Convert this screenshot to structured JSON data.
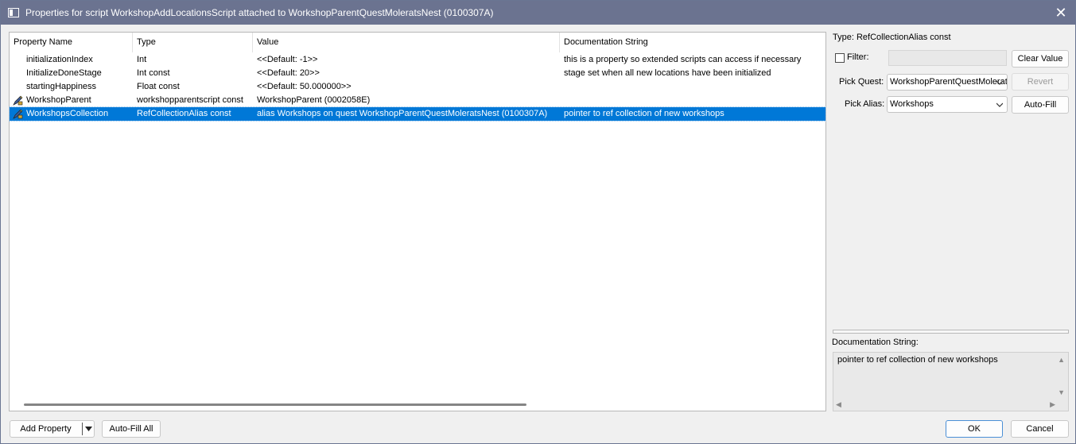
{
  "window": {
    "title": "Properties for script WorkshopAddLocationsScript attached to WorkshopParentQuestMoleratsNest (0100307A)",
    "close_glyph": "✕"
  },
  "table": {
    "columns": [
      "Property Name",
      "Type",
      "Value",
      "Documentation String"
    ],
    "rows": [
      {
        "name": "initializationIndex",
        "type": "Int",
        "value": "<<Default: -1>>",
        "doc": "this is a property so extended scripts can access if necessary",
        "icon": "",
        "selected": false
      },
      {
        "name": "InitializeDoneStage",
        "type": "Int const",
        "value": "<<Default: 20>>",
        "doc": "stage set when all new locations have been initialized",
        "icon": "",
        "selected": false
      },
      {
        "name": "startingHappiness",
        "type": "Float const",
        "value": "<<Default: 50.000000>>",
        "doc": "",
        "icon": "",
        "selected": false
      },
      {
        "name": "WorkshopParent",
        "type": "workshopparentscript const",
        "value": "WorkshopParent (0002058E)",
        "doc": "",
        "icon": "pen-property-icon",
        "selected": false
      },
      {
        "name": "WorkshopsCollection",
        "type": "RefCollectionAlias const",
        "value": "alias Workshops on quest WorkshopParentQuestMoleratsNest (0100307A)",
        "doc": "pointer to ref collection of new workshops",
        "icon": "pen-property-icon",
        "selected": true
      }
    ]
  },
  "right_panel": {
    "type_label": "Type: RefCollectionAlias const",
    "filter_label": "Filter:",
    "filter_checked": false,
    "clear_value_label": "Clear Value",
    "pick_quest_label": "Pick Quest:",
    "pick_quest_value": "WorkshopParentQuestMoleratsNest",
    "revert_label": "Revert",
    "pick_alias_label": "Pick Alias:",
    "pick_alias_value": "Workshops",
    "auto_fill_label": "Auto-Fill",
    "doc_label": "Documentation String:",
    "doc_text": "pointer to ref collection of new workshops"
  },
  "footer": {
    "add_property_label": "Add Property",
    "auto_fill_all_label": "Auto-Fill All",
    "ok_label": "OK",
    "cancel_label": "Cancel"
  },
  "colors": {
    "titlebar": "#6b7390",
    "selection": "#0078d7"
  }
}
